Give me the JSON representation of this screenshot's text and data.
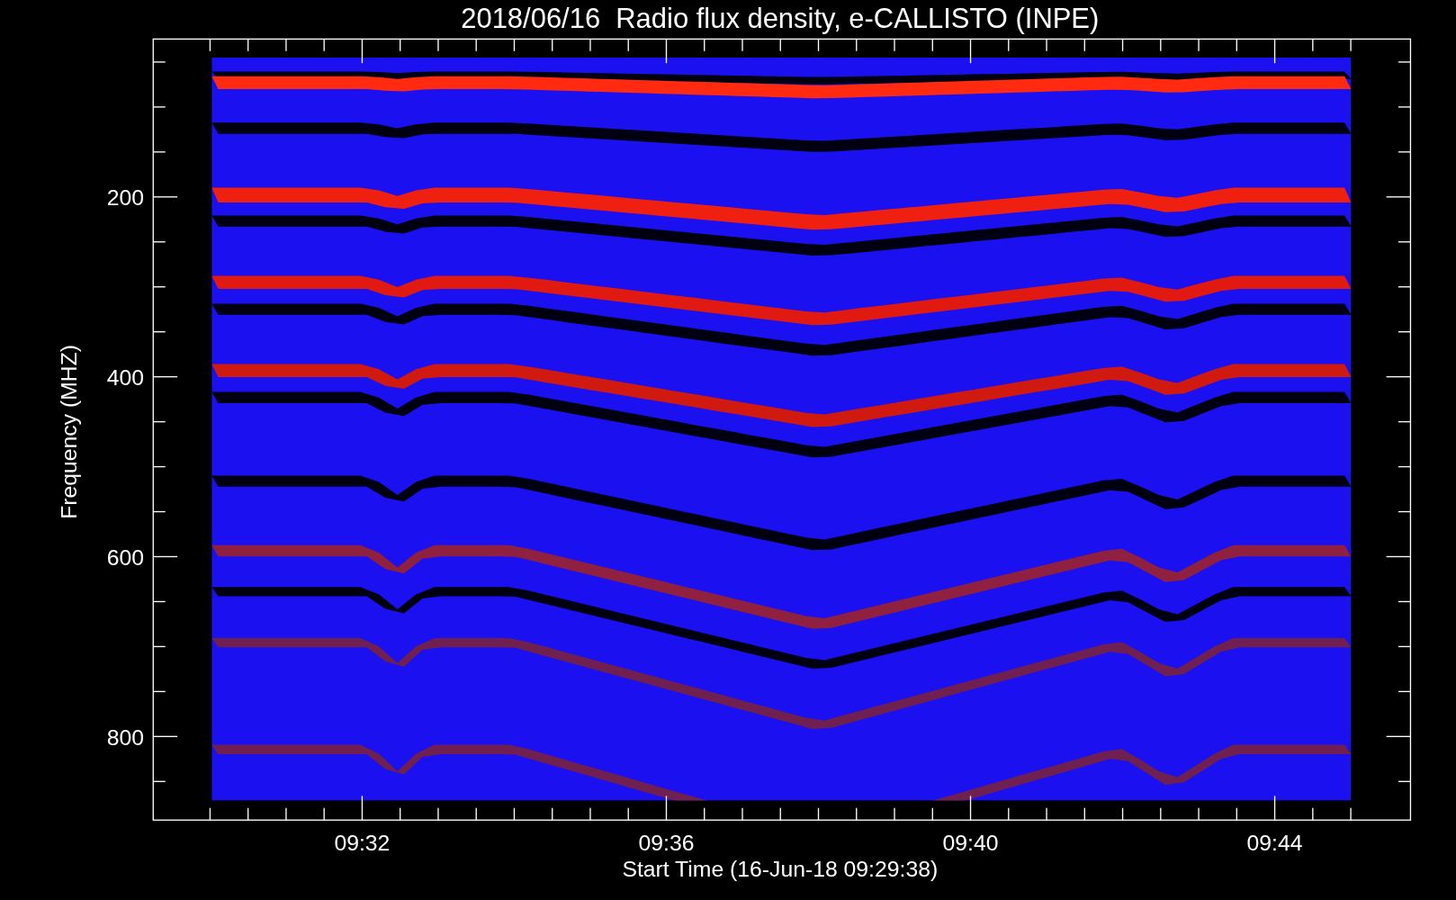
{
  "plot": {
    "title": "2018/06/16  Radio flux density, e-CALLISTO (INPE)",
    "y_axis": {
      "label": "Frequency (MHZ)",
      "ticks": [
        "200",
        "400",
        "600",
        "800"
      ]
    },
    "x_axis": {
      "label": "Start Time (16-Jun-18 09:29:38)",
      "ticks": [
        "09:32",
        "09:36",
        "09:40",
        "09:44"
      ]
    }
  }
}
